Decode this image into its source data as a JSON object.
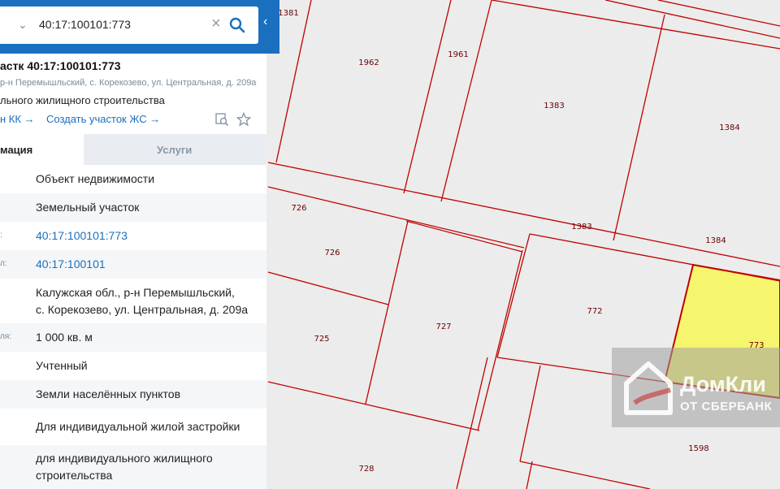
{
  "search": {
    "value": "40:17:100101:773",
    "clear_glyph": "×",
    "chevron_glyph": "⌄",
    "collapse_glyph": "‹"
  },
  "card": {
    "title": "астк 40:17:100101:773",
    "address": "р-н Перемышльский, с. Корекозево, ул. Центральная, д. 209а",
    "use": "льного жилищного строительства",
    "link_kk": "н КК →",
    "link_create": "Создать участок ЖС →"
  },
  "tabs": {
    "info": "мация",
    "services": "Услуги"
  },
  "rows": [
    {
      "label": "",
      "value": "Объект недвижимости",
      "link": false
    },
    {
      "label": "",
      "value": "Земельный участок",
      "link": false
    },
    {
      "label": ":",
      "value": "40:17:100101:773",
      "link": true
    },
    {
      "label": "л:",
      "value": "40:17:100101",
      "link": true
    },
    {
      "label": "",
      "value": "Калужская обл., р-н Перемышльский,\nс. Корекозево, ул. Центральная, д. 209а",
      "link": false
    },
    {
      "label": "ля:",
      "value": "1 000 кв. м",
      "link": false
    },
    {
      "label": "",
      "value": "Учтенный",
      "link": false
    },
    {
      "label": "",
      "value": "Земли населённых пунктов",
      "link": false
    },
    {
      "label": "",
      "value": "Для индивидуальной жилой застройки",
      "link": false
    },
    {
      "label": "",
      "value": "для индивидуального жилищного\nстроительства",
      "link": false
    }
  ],
  "map": {
    "plot_labels": [
      "1381",
      "1962",
      "1961",
      "1383",
      "1384",
      "726",
      "726",
      "1383",
      "1384",
      "772",
      "773",
      "725",
      "727",
      "728",
      "1598"
    ],
    "colors": {
      "boundary": "#c00000",
      "selected_fill": "#f5f56e",
      "background": "#ececec"
    }
  },
  "watermark": {
    "line1": "ДомКли",
    "line2": "ОТ СБЕРБАНК"
  },
  "colors": {
    "accent": "#1b6fbf",
    "tab_inactive": "#e9edf1"
  },
  "icons": [
    "chevron-down-icon",
    "clear-icon",
    "search-icon",
    "collapse-arrow-icon",
    "map-search-icon",
    "star-icon",
    "home-logo-icon"
  ]
}
